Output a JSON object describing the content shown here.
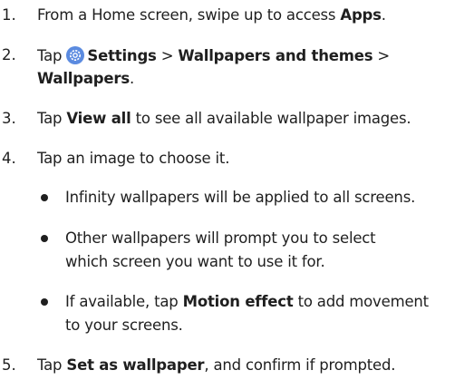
{
  "steps": [
    {
      "number": "1.",
      "pre": "From a Home screen, swipe up to access ",
      "apps": "Apps",
      "end": "."
    },
    {
      "number": "2.",
      "tap": "Tap ",
      "settings": "Settings",
      "sep1": " > ",
      "wallpapers_themes": "Wallpapers and themes",
      "sep2": " >",
      "wallpapers": "Wallpapers",
      "end": "."
    },
    {
      "number": "3.",
      "tap": "Tap ",
      "view_all": "View all",
      "rest": " to see all available wallpaper images."
    },
    {
      "number": "4.",
      "text": "Tap an image to choose it.",
      "bullets": {
        "infinity": "Infinity wallpapers will be applied to all screens.",
        "other_line1": "Other wallpapers will prompt you to select",
        "other_line2": "which screen you want to use it for.",
        "motion_pre": "If available, tap ",
        "motion_bold": "Motion effect",
        "motion_post": " to add movement",
        "motion_line2": "to your screens."
      }
    },
    {
      "number": "5.",
      "tap": "Tap ",
      "set_wallpaper": "Set as wallpaper",
      "rest": ", and confirm if prompted."
    }
  ],
  "icons": {
    "settings_icon": "gear-icon",
    "settings_icon_color": "#5b8be0"
  }
}
